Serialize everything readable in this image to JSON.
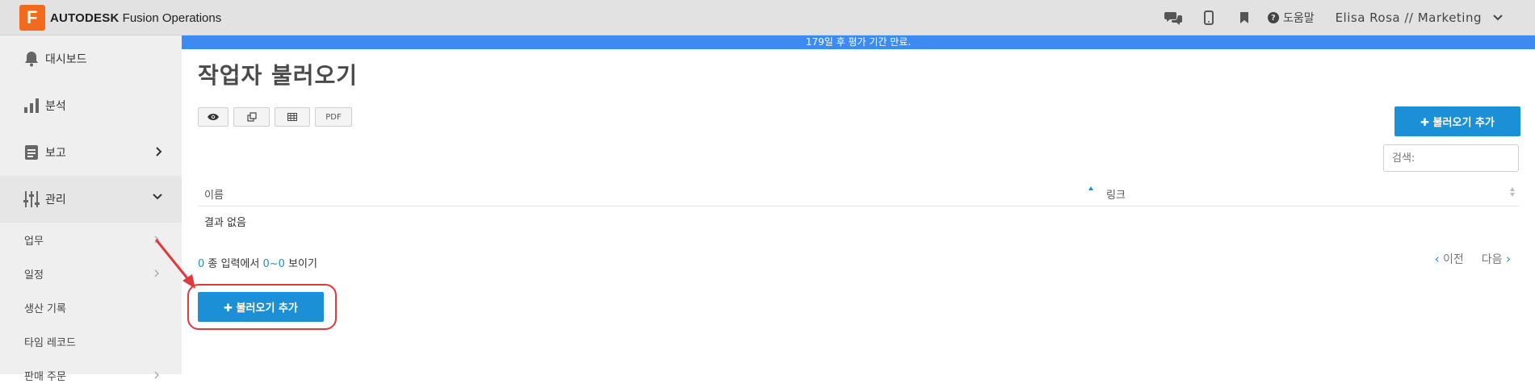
{
  "app": {
    "brand_strong": "AUTODESK",
    "brand_product": "Fusion Operations",
    "logo_letter": "F"
  },
  "header": {
    "help_label": "도움말",
    "user_label": "Elisa Rosa // Marketing"
  },
  "banner": {
    "text": "179일 후 평가 기간 만료."
  },
  "sidebar": {
    "items": [
      {
        "label": "대시보드",
        "icon": "bell-icon"
      },
      {
        "label": "분석",
        "icon": "bar-chart-icon"
      },
      {
        "label": "보고",
        "icon": "document-icon"
      },
      {
        "label": "관리",
        "icon": "sliders-icon"
      }
    ],
    "subitems": [
      {
        "label": "업무"
      },
      {
        "label": "일정"
      },
      {
        "label": "생산 기록"
      },
      {
        "label": "타임 레코드"
      },
      {
        "label": "판매 주문"
      }
    ]
  },
  "page": {
    "title": "작업자 불러오기",
    "add_button": "✚ 불러오기 추가",
    "search_placeholder": "검색:",
    "tools": [
      {
        "icon": "eye-icon"
      },
      {
        "icon": "copy-icon"
      },
      {
        "icon": "table-icon"
      },
      {
        "label": "PDF"
      }
    ]
  },
  "table": {
    "columns": [
      "이름",
      "링크"
    ],
    "empty_text": "결과 없음"
  },
  "footer": {
    "info_prefix": "0",
    "info_mid": " 종 입력에서 ",
    "info_range": "0~0",
    "info_suffix": " 보이기",
    "prev_label": "이전",
    "next_label": "다음"
  },
  "colors": {
    "accent": "#1b90d6",
    "banner": "#3d8bf0",
    "brand": "#f26b1d",
    "annotation": "#e0393b"
  }
}
